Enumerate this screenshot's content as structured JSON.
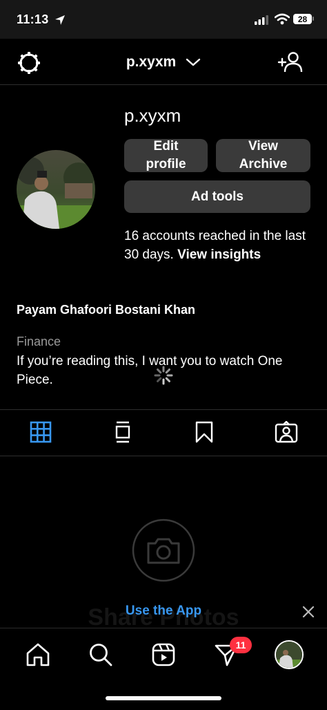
{
  "status_bar": {
    "time": "11:13",
    "battery": "28"
  },
  "header": {
    "username": "p.xyxm"
  },
  "profile": {
    "username": "p.xyxm",
    "edit_profile_label": "Edit\nprofile",
    "view_archive_label": "View\nArchive",
    "ad_tools_label": "Ad tools",
    "reach_text": "16 accounts reached in the last 30 days.",
    "view_insights_label": "View insights",
    "full_name": "Payam Ghafoori Bostani Khan",
    "category": "Finance",
    "bio": "If you’re reading this, I want you to watch One Piece."
  },
  "empty_state": {
    "ghost_text": "Share Photos"
  },
  "app_banner": {
    "label": "Use the App"
  },
  "bottom_nav": {
    "messages_badge": "11"
  },
  "colors": {
    "accent": "#3897f0",
    "badge": "#ff3040",
    "button_bg": "#3a3a3a"
  }
}
